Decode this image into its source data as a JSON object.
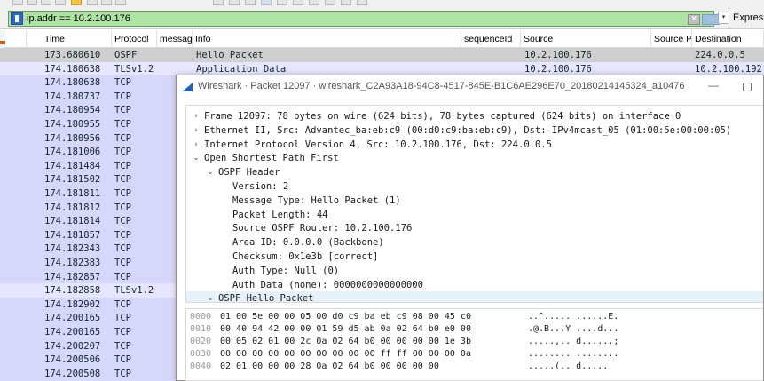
{
  "display_filter": {
    "value": "ip.addr == 10.2.100.176",
    "expression_label": "Expression...",
    "clear_glyph": "×",
    "apply_glyph": "→",
    "dropdown_glyph": "▾"
  },
  "packet_list": {
    "columns": [
      "Time",
      "Protocol",
      "messag",
      "Info",
      "sequenceId",
      "Source",
      "Source P",
      "Destination"
    ],
    "rows": [
      {
        "time": "173.680610",
        "protocol": "OSPF",
        "info": "Hello Packet",
        "source": "10.2.100.176",
        "destination": "224.0.0.5",
        "selected": true
      },
      {
        "time": "174.180638",
        "protocol": "TLSv1.2",
        "info": "Application Data",
        "source": "10.2.100.176",
        "destination": "10.2.100.192"
      },
      {
        "time": "174.180638",
        "protocol": "TCP"
      },
      {
        "time": "174.180737",
        "protocol": "TCP"
      },
      {
        "time": "174.180954",
        "protocol": "TCP"
      },
      {
        "time": "174.180955",
        "protocol": "TCP"
      },
      {
        "time": "174.180956",
        "protocol": "TCP"
      },
      {
        "time": "174.181006",
        "protocol": "TCP"
      },
      {
        "time": "174.181484",
        "protocol": "TCP"
      },
      {
        "time": "174.181502",
        "protocol": "TCP"
      },
      {
        "time": "174.181811",
        "protocol": "TCP"
      },
      {
        "time": "174.181812",
        "protocol": "TCP"
      },
      {
        "time": "174.181814",
        "protocol": "TCP"
      },
      {
        "time": "174.181857",
        "protocol": "TCP"
      },
      {
        "time": "174.182343",
        "protocol": "TCP"
      },
      {
        "time": "174.182383",
        "protocol": "TCP"
      },
      {
        "time": "174.182857",
        "protocol": "TCP"
      },
      {
        "time": "174.182858",
        "protocol": "TLSv1.2"
      },
      {
        "time": "174.182902",
        "protocol": "TCP"
      },
      {
        "time": "174.200165",
        "protocol": "TCP"
      },
      {
        "time": "174.200165",
        "protocol": "TCP"
      },
      {
        "time": "174.200207",
        "protocol": "TCP"
      },
      {
        "time": "174.200506",
        "protocol": "TCP"
      },
      {
        "time": "174.200508",
        "protocol": "TCP"
      }
    ]
  },
  "packet_window": {
    "title": "Wireshark · Packet 12097 · wireshark_C2A93A18-94C8-4517-845E-B1C6AE296E70_20180214145324_a10476",
    "minimize_glyph": "—",
    "tree": [
      {
        "text": "Frame 12097: 78 bytes on wire (624 bits), 78 bytes captured (624 bits) on interface 0",
        "depth": 0,
        "arrow": "›"
      },
      {
        "text": "Ethernet II, Src: Advantec_ba:eb:c9 (00:d0:c9:ba:eb:c9), Dst: IPv4mcast_05 (01:00:5e:00:00:05)",
        "depth": 0,
        "arrow": "›"
      },
      {
        "text": "Internet Protocol Version 4, Src: 10.2.100.176, Dst: 224.0.0.5",
        "depth": 0,
        "arrow": "›"
      },
      {
        "text": "Open Shortest Path First",
        "depth": 0,
        "arrow": "⌄"
      },
      {
        "text": "OSPF Header",
        "depth": 1,
        "arrow": "⌄"
      },
      {
        "text": "Version: 2",
        "depth": 2,
        "arrow": ""
      },
      {
        "text": "Message Type: Hello Packet (1)",
        "depth": 2,
        "arrow": ""
      },
      {
        "text": "Packet Length: 44",
        "depth": 2,
        "arrow": ""
      },
      {
        "text": "Source OSPF Router: 10.2.100.176",
        "depth": 2,
        "arrow": ""
      },
      {
        "text": "Area ID: 0.0.0.0 (Backbone)",
        "depth": 2,
        "arrow": ""
      },
      {
        "text": "Checksum: 0x1e3b [correct]",
        "depth": 2,
        "arrow": ""
      },
      {
        "text": "Auth Type: Null (0)",
        "depth": 2,
        "arrow": ""
      },
      {
        "text": "Auth Data (none): 0000000000000000",
        "depth": 2,
        "arrow": ""
      },
      {
        "text": "OSPF Hello Packet",
        "depth": 1,
        "arrow": "⌄",
        "selected": true
      }
    ],
    "hex": [
      {
        "offset": "0000",
        "bytes": "01 00 5e 00 00 05 00 d0  c9 ba eb c9 08 00 45 c0",
        "ascii": "..^..... ......E."
      },
      {
        "offset": "0010",
        "bytes": "00 40 94 42 00 00 01 59  d5 ab 0a 02 64 b0 e0 00",
        "ascii": ".@.B...Y ....d..."
      },
      {
        "offset": "0020",
        "bytes": "00 05 02 01 00 2c 0a 02  64 b0 00 00 00 00 1e 3b",
        "ascii": ".....,.. d......;"
      },
      {
        "offset": "0030",
        "bytes": "00 00 00 00 00 00 00 00  00 00 ff ff 00 00 00 0a",
        "ascii": "........ ........"
      },
      {
        "offset": "0040",
        "bytes": "02 01 00 00 00 28 0a 02  64 b0 00 00 00 00",
        "ascii": ".....(.. d....."
      }
    ]
  },
  "colors": {
    "filter_valid_bg": "#afe2a5",
    "tcp_row_bg": "#d7d6fb",
    "tls_row_bg": "#e7e6ff",
    "selected_row_bg": "#cfcfcf",
    "text_dark": "#12272e"
  }
}
